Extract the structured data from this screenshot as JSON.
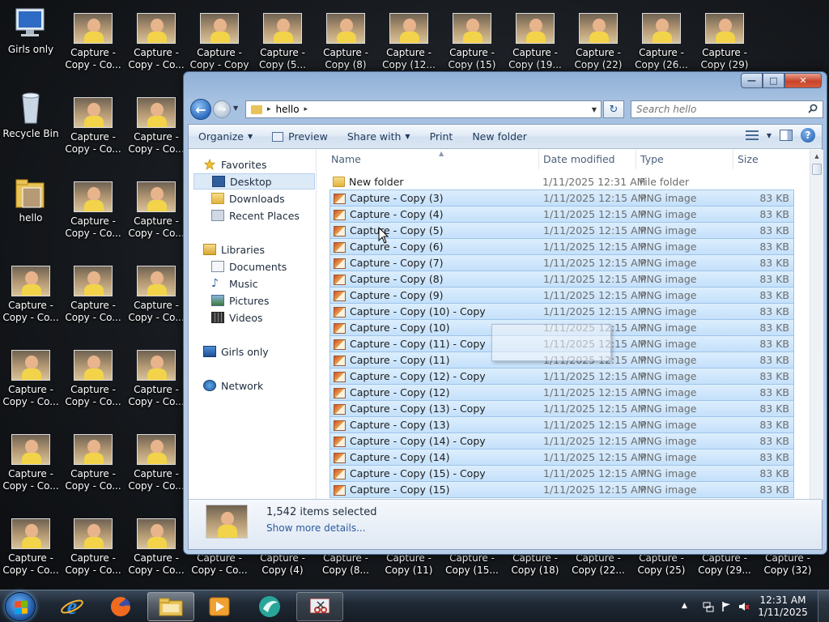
{
  "desktop": {
    "system_icons": [
      {
        "label": "Girls only",
        "icon": "computer-icon"
      },
      {
        "label": "Recycle Bin",
        "icon": "recycle-bin-icon"
      },
      {
        "label": "hello",
        "icon": "folder-icon"
      }
    ],
    "top_row_labels": [
      "Capture - Copy - Co...",
      "Capture - Copy - Co...",
      "Capture - Copy - Copy",
      "Capture - Copy (5...",
      "Capture - Copy (8)",
      "Capture - Copy (12...",
      "Capture - Copy (15)",
      "Capture - Copy (19...",
      "Capture - Copy (22)",
      "Capture - Copy (26...",
      "Capture - Copy (29)"
    ],
    "bottom_row_labels": [
      "Capture - Copy - Co...",
      "Capture - Copy - Co...",
      "Capture - Copy - Co...",
      "Capture - Copy - Co...",
      "Capture - Copy (4)",
      "Capture - Copy (8...",
      "Capture - Copy (11)",
      "Capture - Copy (15...",
      "Capture - Copy (18)",
      "Capture - Copy (22...",
      "Capture - Copy (25)",
      "Capture - Copy (29...",
      "Capture - Copy (32)"
    ],
    "grid_label": "Capture - Copy - Co..."
  },
  "window": {
    "minimize_label": "—",
    "maximize_label": "□",
    "close_label": "✕",
    "address": {
      "crumb": "hello",
      "separator": "▸"
    },
    "search": {
      "placeholder": "Search hello"
    },
    "toolbar": {
      "organize": "Organize",
      "preview": "Preview",
      "share_with": "Share with",
      "print": "Print",
      "new_folder": "New folder",
      "help": "?"
    },
    "nav": {
      "favorites": "Favorites",
      "desktop": "Desktop",
      "downloads": "Downloads",
      "recent_places": "Recent Places",
      "libraries": "Libraries",
      "documents": "Documents",
      "music": "Music",
      "pictures": "Pictures",
      "videos": "Videos",
      "homegroup": "Girls only",
      "network": "Network"
    },
    "columns": {
      "name": "Name",
      "date": "Date modified",
      "type": "Type",
      "size": "Size"
    },
    "files": [
      {
        "name": "New folder",
        "date": "1/11/2025 12:31 AM",
        "type": "File folder",
        "size": "",
        "kind": "folder",
        "selected": false
      },
      {
        "name": "Capture - Copy (3)",
        "date": "1/11/2025 12:15 AM",
        "type": "PNG image",
        "size": "83 KB",
        "kind": "png",
        "selected": true
      },
      {
        "name": "Capture - Copy (4)",
        "date": "1/11/2025 12:15 AM",
        "type": "PNG image",
        "size": "83 KB",
        "kind": "png",
        "selected": true
      },
      {
        "name": "Capture - Copy (5)",
        "date": "1/11/2025 12:15 AM",
        "type": "PNG image",
        "size": "83 KB",
        "kind": "png",
        "selected": true
      },
      {
        "name": "Capture - Copy (6)",
        "date": "1/11/2025 12:15 AM",
        "type": "PNG image",
        "size": "83 KB",
        "kind": "png",
        "selected": true
      },
      {
        "name": "Capture - Copy (7)",
        "date": "1/11/2025 12:15 AM",
        "type": "PNG image",
        "size": "83 KB",
        "kind": "png",
        "selected": true
      },
      {
        "name": "Capture - Copy (8)",
        "date": "1/11/2025 12:15 AM",
        "type": "PNG image",
        "size": "83 KB",
        "kind": "png",
        "selected": true
      },
      {
        "name": "Capture - Copy (9)",
        "date": "1/11/2025 12:15 AM",
        "type": "PNG image",
        "size": "83 KB",
        "kind": "png",
        "selected": true
      },
      {
        "name": "Capture - Copy (10) - Copy",
        "date": "1/11/2025 12:15 AM",
        "type": "PNG image",
        "size": "83 KB",
        "kind": "png",
        "selected": true
      },
      {
        "name": "Capture - Copy (10)",
        "date": "1/11/2025 12:15 AM",
        "type": "PNG image",
        "size": "83 KB",
        "kind": "png",
        "selected": true
      },
      {
        "name": "Capture - Copy (11) - Copy",
        "date": "1/11/2025 12:15 AM",
        "type": "PNG image",
        "size": "83 KB",
        "kind": "png",
        "selected": true
      },
      {
        "name": "Capture - Copy (11)",
        "date": "1/11/2025 12:15 AM",
        "type": "PNG image",
        "size": "83 KB",
        "kind": "png",
        "selected": true
      },
      {
        "name": "Capture - Copy (12) - Copy",
        "date": "1/11/2025 12:15 AM",
        "type": "PNG image",
        "size": "83 KB",
        "kind": "png",
        "selected": true
      },
      {
        "name": "Capture - Copy (12)",
        "date": "1/11/2025 12:15 AM",
        "type": "PNG image",
        "size": "83 KB",
        "kind": "png",
        "selected": true
      },
      {
        "name": "Capture - Copy (13) - Copy",
        "date": "1/11/2025 12:15 AM",
        "type": "PNG image",
        "size": "83 KB",
        "kind": "png",
        "selected": true
      },
      {
        "name": "Capture - Copy (13)",
        "date": "1/11/2025 12:15 AM",
        "type": "PNG image",
        "size": "83 KB",
        "kind": "png",
        "selected": true
      },
      {
        "name": "Capture - Copy (14) - Copy",
        "date": "1/11/2025 12:15 AM",
        "type": "PNG image",
        "size": "83 KB",
        "kind": "png",
        "selected": true
      },
      {
        "name": "Capture - Copy (14)",
        "date": "1/11/2025 12:15 AM",
        "type": "PNG image",
        "size": "83 KB",
        "kind": "png",
        "selected": true
      },
      {
        "name": "Capture - Copy (15) - Copy",
        "date": "1/11/2025 12:15 AM",
        "type": "PNG image",
        "size": "83 KB",
        "kind": "png",
        "selected": true
      },
      {
        "name": "Capture - Copy (15)",
        "date": "1/11/2025 12:15 AM",
        "type": "PNG image",
        "size": "83 KB",
        "kind": "png",
        "selected": true
      }
    ],
    "details": {
      "count": "1,542 items selected",
      "more": "Show more details..."
    }
  },
  "taskbar": {
    "apps": [
      "internet-explorer-icon",
      "firefox-icon",
      "windows-explorer-icon",
      "media-player-icon",
      "bird-app-icon",
      "snipping-tool-icon"
    ],
    "active_app": "windows-explorer-icon",
    "clock_time": "12:31 AM",
    "clock_date": "1/11/2025"
  },
  "colors": {
    "selection_fill": "#cce4fb",
    "selection_border": "#9fc4ea",
    "window_frame": "#a6c1e1",
    "toolbar_text": "#1e395b"
  }
}
